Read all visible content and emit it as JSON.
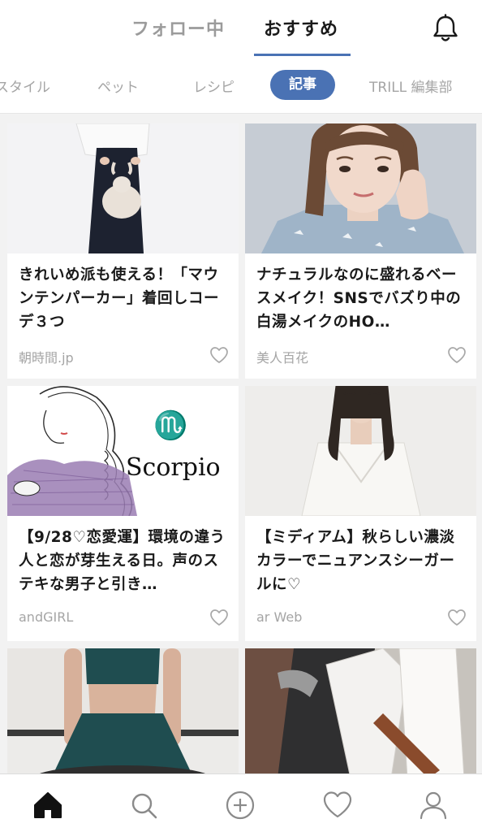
{
  "header": {
    "tabs": [
      "フォロー中",
      "おすすめ"
    ],
    "active_tab": "おすすめ",
    "accent_color": "#4a72b4"
  },
  "categories": {
    "items": [
      "スタイル",
      "ペット",
      "レシピ",
      "記事",
      "TRILL 編集部"
    ],
    "selected": "記事"
  },
  "cards": [
    {
      "title": "きれいめ派も使える！「マウンテンパーカー」着回しコーデ３つ",
      "source": "朝時間.jp"
    },
    {
      "title": "ナチュラルなのに盛れるベースメイク！SNSでバズり中の白湯メイクのHO…",
      "source": "美人百花"
    },
    {
      "title": "【9/28♡恋愛運】環境の違う人と恋が芽生える日。声のステキな男子と引き…",
      "source": "andGIRL",
      "image_text": "Scorpio"
    },
    {
      "title": "【ミディアム】秋らしい濃淡カラーでニュアンスシーガールに♡",
      "source": "ar Web"
    }
  ],
  "icons": {
    "header": "bell-icon",
    "card_action": "heart-icon",
    "bottom_nav": [
      "home-icon",
      "search-icon",
      "add-icon",
      "favorites-icon",
      "profile-icon"
    ]
  }
}
